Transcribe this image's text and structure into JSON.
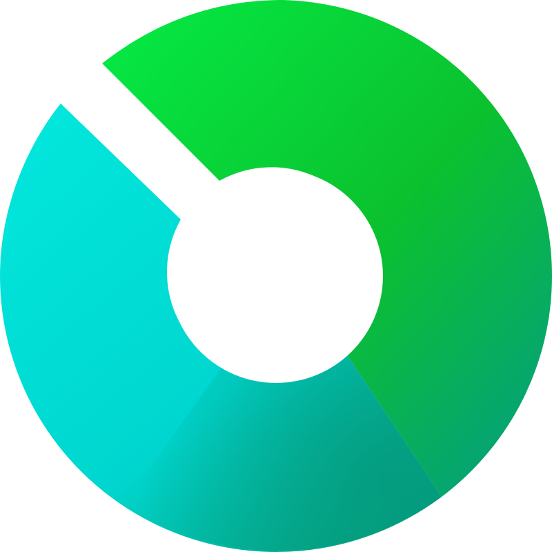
{
  "logo": {
    "icon": "donut-ring-logo-icon",
    "colors": {
      "green_top": "#05E843",
      "green_right": "#0BC12E",
      "teal_bottom": "#05A07C",
      "cyan_left": "#02E6DC",
      "cyan_mid": "#00D6CF",
      "background": "#FFFFFF"
    }
  }
}
